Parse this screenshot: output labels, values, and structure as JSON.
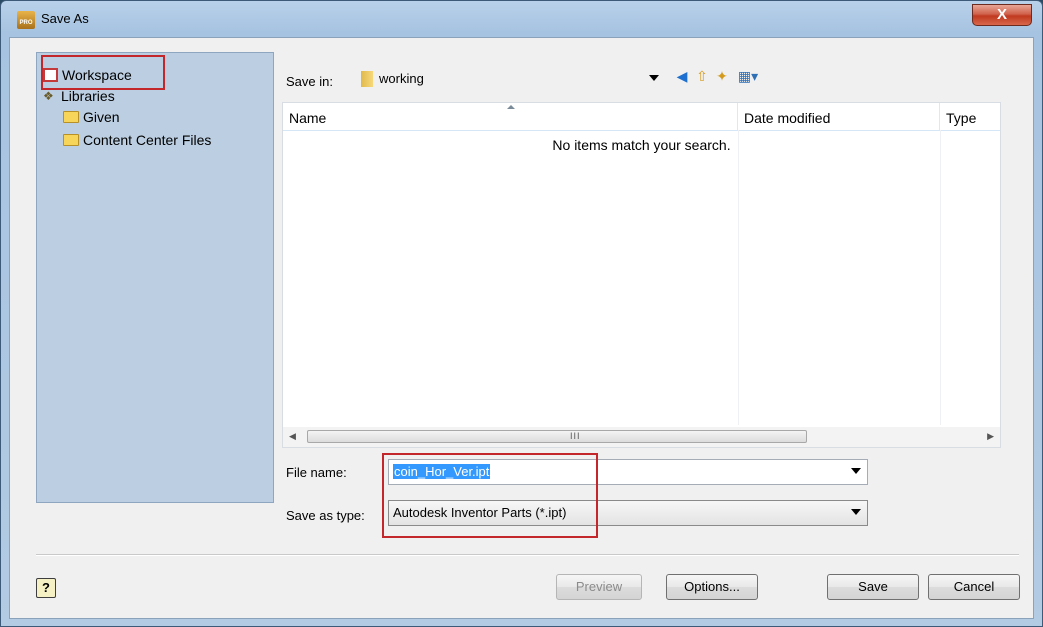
{
  "window": {
    "title": "Save As",
    "app_icon_label": "PRO",
    "close_label": "X"
  },
  "nav": {
    "items": [
      {
        "label": "Workspace",
        "icon": "workspace-icon"
      },
      {
        "label": "Libraries",
        "icon": "libraries-icon"
      },
      {
        "label": "Given",
        "icon": "folder-icon"
      },
      {
        "label": "Content Center Files",
        "icon": "folder-icon"
      }
    ]
  },
  "save_in": {
    "label": "Save in:",
    "value": "working"
  },
  "toolbar": {
    "icons": [
      "back-icon",
      "up-folder-icon",
      "new-folder-icon",
      "view-menu-icon"
    ]
  },
  "file_list": {
    "columns": [
      "Name",
      "Date modified",
      "Type"
    ],
    "empty_message": "No items match your search.",
    "scroll_grip": "III"
  },
  "file_name": {
    "label": "File name:",
    "value": "coin_Hor_Ver.ipt"
  },
  "save_as_type": {
    "label": "Save as type:",
    "value": "Autodesk Inventor Parts (*.ipt)"
  },
  "buttons": {
    "help": "?",
    "preview": "Preview",
    "options": "Options...",
    "save": "Save",
    "cancel": "Cancel"
  },
  "colors": {
    "highlight": "#c3262b",
    "nav_bg": "#bccfe2",
    "selection": "#3399ff"
  }
}
